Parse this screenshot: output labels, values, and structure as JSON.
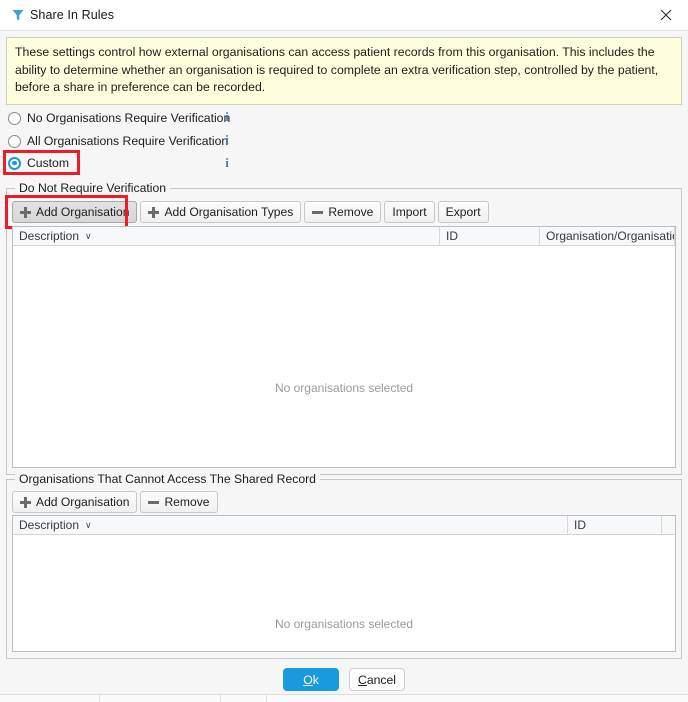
{
  "window": {
    "title": "Share In Rules",
    "icon": "filter-funnel-icon",
    "close_label": "✕"
  },
  "info_banner": {
    "text": "These settings control how external organisations can access patient records from this organisation. This includes the ability to determine whether an organisation is required to complete an extra verification step, controlled by the patient, before a share in preference can be recorded."
  },
  "verification_options": {
    "items": [
      {
        "label": "No Organisations Require Verification",
        "checked": false,
        "info_icon": "info-icon",
        "info_glyph": "i"
      },
      {
        "label": "All Organisations Require Verification",
        "checked": false,
        "info_icon": "info-icon",
        "info_glyph": "i"
      },
      {
        "label": "Custom",
        "checked": true,
        "info_icon": "info-icon",
        "info_glyph": "i"
      }
    ]
  },
  "do_not_require_verification": {
    "group_title": "Do Not Require Verification",
    "toolbar": [
      {
        "label": "Add Organisation",
        "icon": "plus-icon",
        "state": "pressed"
      },
      {
        "label": "Add Organisation Types",
        "icon": "plus-icon",
        "state": "normal"
      },
      {
        "label": "Remove",
        "icon": "minus-icon",
        "state": "normal"
      },
      {
        "label": "Import",
        "icon": "none",
        "state": "normal"
      },
      {
        "label": "Export",
        "icon": "none",
        "state": "normal"
      }
    ],
    "table": {
      "columns": [
        {
          "label": "Description",
          "sort_caret": "∨"
        },
        {
          "label": "ID",
          "sort_caret": ""
        },
        {
          "label": "Organisation/Organisation ...",
          "sort_caret": ""
        }
      ],
      "rows": [],
      "empty_message": "No organisations selected"
    }
  },
  "cannot_access": {
    "group_title": "Organisations That Cannot Access The Shared Record",
    "toolbar": [
      {
        "label": "Add Organisation",
        "icon": "plus-icon",
        "state": "normal"
      },
      {
        "label": "Remove",
        "icon": "minus-icon",
        "state": "normal"
      }
    ],
    "table": {
      "columns": [
        {
          "label": "Description",
          "sort_caret": "∨"
        },
        {
          "label": "ID",
          "sort_caret": ""
        }
      ],
      "rows": [],
      "empty_message": "No organisations selected"
    }
  },
  "footer": {
    "ok_label": "Ok",
    "ok_accel": "O",
    "ok_rest": "k",
    "cancel_accel": "C",
    "cancel_rest": "ancel",
    "cancel_label": "Cancel"
  },
  "colors": {
    "accent": "#1a9ade",
    "highlight": "#ee1c25",
    "banner_bg": "#ffffdd",
    "info_icon": "#4a7eb5"
  }
}
